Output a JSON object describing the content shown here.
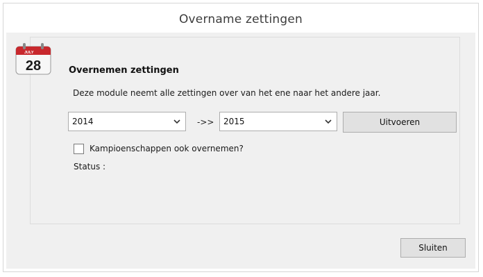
{
  "window": {
    "title": "Overname zettingen"
  },
  "icon": {
    "name": "calendar-icon",
    "month": "JULY",
    "day": "28",
    "accent": "#c8282d"
  },
  "content": {
    "heading": "Overnemen zettingen",
    "description": "Deze module neemt alle zettingen over van het ene naar het andere jaar.",
    "from_year": "2014",
    "arrow": "->>",
    "to_year": "2015",
    "execute_label": "Uitvoeren",
    "checkbox_label": "Kampioenschappen ook overnemen?",
    "checkbox_checked": false,
    "status_label": "Status :"
  },
  "footer": {
    "close_label": "Sluiten"
  }
}
